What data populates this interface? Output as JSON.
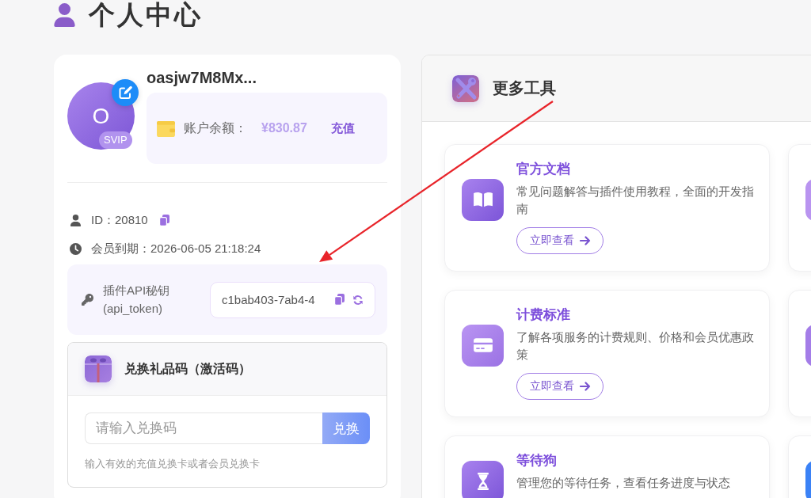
{
  "page": {
    "title": "个人中心"
  },
  "profile": {
    "avatar_letter": "O",
    "membership": "SVIP",
    "username": "oasjw7M8Mx...",
    "balance": {
      "label": "账户余额：",
      "amount": "¥830.87",
      "action": "充值"
    }
  },
  "details": [
    {
      "kind": "id",
      "text": "ID：20810",
      "copyable": true
    },
    {
      "kind": "expiry",
      "text": "会员到期：2026-06-05 21:18:24",
      "copyable": false
    }
  ],
  "api_key": {
    "label": "插件API秘钥",
    "sublabel": "(api_token)",
    "value": "c1bab403-7ab4-4"
  },
  "redeem": {
    "title": "兑换礼品码（激活码）",
    "placeholder": "请输入兑换码",
    "button": "兑换",
    "hint": "输入有效的充值兑换卡或者会员兑换卡"
  },
  "tools": {
    "title": "更多工具",
    "cards": [
      {
        "kind": "full",
        "title": "官方文档",
        "description": "常见问题解答与插件使用教程，全面的开发指南",
        "button": "立即查看"
      },
      {
        "kind": "clipped",
        "color": "#b994f0"
      },
      {
        "kind": "full",
        "title": "计费标准",
        "description": "了解各项服务的计费规则、价格和会员优惠政策",
        "button": "立即查看"
      },
      {
        "kind": "clipped",
        "color": "#a47de8"
      },
      {
        "kind": "full",
        "title": "等待狗",
        "description": "管理您的等待任务，查看任务进度与状态"
      },
      {
        "kind": "clipped",
        "color": "#3b82f6"
      }
    ]
  },
  "annotations": [
    {
      "kind": "arrow"
    }
  ]
}
